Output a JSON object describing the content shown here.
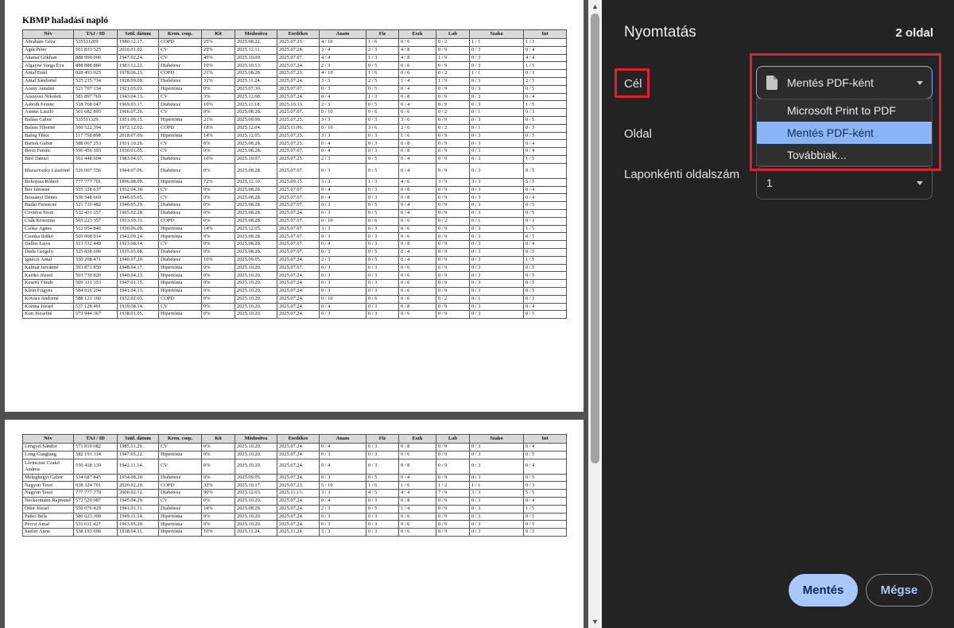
{
  "preview": {
    "doc_title": "KBMP haladási napló",
    "columns": [
      "Név",
      "TAJ / ID",
      "Szül. dátum",
      "Kron. csop.",
      "Kit",
      "Módosítva",
      "Esedékes",
      "Anam",
      "Fiz",
      "Eszk",
      "Lab",
      "Szako",
      "Int"
    ],
    "page1_rows": [
      [
        "Ábrahám Géza",
        "535511209",
        "1980.12.17.",
        "COPD",
        "25%",
        "2025.08.22.",
        "2025.07.23.",
        "4 / 10",
        "1 / 6",
        "0 / 6",
        "0 / 2",
        "1 / 1",
        "1 / 3"
      ],
      [
        "Ágút Péter",
        "561 833 525",
        "2010.01.02.",
        "CV",
        "29%",
        "2025.12.11.",
        "2025.07.28.",
        "3 / 4",
        "2 / 3",
        "4 / 8",
        "0 / 9",
        "0 / 3",
        "0 / 4"
      ],
      [
        "Akarsu Gökhan",
        "888 999 000",
        "1947.02.24.",
        "CV",
        "45%",
        "2025.10.09.",
        "2025.07.07.",
        "4 / 4",
        "1 / 3",
        "4 / 8",
        "1 / 9",
        "0 / 3",
        "4 / 4"
      ],
      [
        "Algayné Varga Éva",
        "888 888 880",
        "1983.12.22.",
        "Diabétesz",
        "10%",
        "2025.10.13.",
        "2025.07.24.",
        "2 / 3",
        "0 / 5",
        "0 / 6",
        "0 / 9",
        "0 / 3",
        "1 / 5"
      ],
      [
        "Antal Emil",
        "028 493 925",
        "1978.06.23.",
        "COPD",
        "21%",
        "2025.08.28.",
        "2025.07.23.",
        "4 / 10",
        "1 / 6",
        "0 / 6",
        "0 / 2",
        "1 / 1",
        "0 / 3"
      ],
      [
        "Antal Sándorné",
        "525 235 734",
        "1928.09.09.",
        "Diabétesz",
        "31%",
        "2025.11.24.",
        "2025.07.24.",
        "3 / 3",
        "2 / 5",
        "1 / 4",
        "1 / 9",
        "0 / 3",
        "2 / 5"
      ],
      [
        "Arany Antalné",
        "521 707 134",
        "1921.05.01.",
        "Hipertónia",
        "0%",
        "2025.07.30.",
        "2025.07.07.",
        "0 / 3",
        "0 / 5",
        "0 / 4",
        "0 / 9",
        "0 / 3",
        "0 / 5"
      ],
      [
        "Aranyosi Nikolett",
        "581 897 769",
        "1943.04.13.",
        "CV",
        "3%",
        "2025.12.08.",
        "2025.07.24.",
        "0 / 4",
        "1 / 3",
        "0 / 8",
        "0 / 9",
        "0 / 3",
        "0 / 4"
      ],
      [
        "Asbóth Ferenc",
        "518 768 047",
        "1969.03.17.",
        "Diabétesz",
        "10%",
        "2025.11.18.",
        "2025.10.13.",
        "2 / 3",
        "0 / 5",
        "0 / 4",
        "0 / 9",
        "0 / 3",
        "1 / 5"
      ],
      [
        "Asmus László",
        "501 682 895",
        "1966.07.26.",
        "CV",
        "0%",
        "2025.08.28.",
        "2025.07.07.",
        "0 / 10",
        "0 / 6",
        "0 / 6",
        "0 / 2",
        "0 / 1",
        "0 / 3"
      ],
      [
        "Baláss Gábor",
        "535511329",
        "1951.09.15.",
        "Hipertónia",
        "21%",
        "2025.09.09.",
        "2025.07.25.",
        "3 / 3",
        "0 / 3",
        "3 / 6",
        "0 / 9",
        "0 / 3",
        "0 / 5"
      ],
      [
        "Baláss Tiborné",
        "560 522 394",
        "1972.12.02.",
        "COPD",
        "18%",
        "2025.12.04.",
        "2025.11.06.",
        "0 / 10",
        "3 / 6",
        "2 / 6",
        "0 / 2",
        "0 / 1",
        "0 / 3"
      ],
      [
        "Balog Tibor",
        "117 758 898",
        "2018.07.09.",
        "Hipertónia",
        "14%",
        "2025.12.05.",
        "2025.07.25.",
        "3 / 3",
        "0 / 3",
        "1 / 6",
        "0 / 9",
        "0 / 3",
        "0 / 5"
      ],
      [
        "Bartok Gábor",
        "588 067 253",
        "1931.10.26.",
        "CV",
        "0%",
        "2025.08.28.",
        "2025.07.25.",
        "0 / 4",
        "0 / 3",
        "0 / 8",
        "0 / 9",
        "0 / 3",
        "0 / 4"
      ],
      [
        "Berzi Ferenc",
        "596 456 393",
        "1930.01.05.",
        "CV",
        "0%",
        "2025.08.28.",
        "2025.07.07.",
        "0 / 4",
        "0 / 3",
        "0 / 8",
        "0 / 9",
        "0 / 3",
        "0 / 4"
      ],
      [
        "Bíró Dániel",
        "561 448 604",
        "1983.04.07.",
        "Diabétesz",
        "10%",
        "2025.10.07.",
        "2025.07.25.",
        "2 / 3",
        "0 / 5",
        "0 / 4",
        "0 / 9",
        "0 / 3",
        "1 / 5"
      ],
      [
        "Blazsovszky Lászlóné",
        "526 007 556",
        "1944.07.06.",
        "Diabétesz",
        "0%",
        "2025.08.28.",
        "2025.07.07.",
        "0 / 3",
        "0 / 5",
        "0 / 4",
        "0 / 9",
        "0 / 3",
        "0 / 5"
      ],
      [
        "Bohojsza Róbert",
        "777 777 701",
        "1996.08.09.",
        "Hipertónia",
        "72%",
        "2025.12.10.",
        "2025.09.15.",
        "3 / 3",
        "1 / 3",
        "4 / 6",
        "3 / 9",
        "3 / 3",
        "5 / 5"
      ],
      [
        "Bor Jánosné",
        "555 328 637",
        "1932.04.30.",
        "CV",
        "0%",
        "2025.08.28.",
        "2025.07.07.",
        "0 / 4",
        "0 / 3",
        "0 / 8",
        "0 / 9",
        "0 / 3",
        "0 / 4"
      ],
      [
        "Bossányi Dénes",
        "530 548 669",
        "1946.05.05.",
        "CV",
        "0%",
        "2025.08.28.",
        "2025.07.07.",
        "0 / 4",
        "0 / 3",
        "0 / 8",
        "0 / 9",
        "0 / 3",
        "0 / 4"
      ],
      [
        "Budai Ferencné",
        "521 710 482",
        "1946.05.29.",
        "Diabétesz",
        "0%",
        "2025.08.28.",
        "2025.07.07.",
        "0 / 3",
        "0 / 5",
        "0 / 4",
        "0 / 9",
        "0 / 3",
        "0 / 5"
      ],
      [
        "Covidos Teszt",
        "532 431 257",
        "1965.02.28.",
        "Diabétesz",
        "0%",
        "2025.08.28.",
        "2025.07.24.",
        "0 / 3",
        "0 / 5",
        "0 / 4",
        "0 / 9",
        "0 / 3",
        "0 / 5"
      ],
      [
        "Csák Krisztina",
        "565 223 357",
        "1933.10.31.",
        "COPD",
        "0%",
        "2025.08.28.",
        "2025.07.07.",
        "0 / 10",
        "0 / 6",
        "0 / 6",
        "0 / 2",
        "0 / 1",
        "0 / 3"
      ],
      [
        "Csóka Ágnes",
        "512 954 846",
        "1930.06.09.",
        "Hipertónia",
        "14%",
        "2025.12.05.",
        "2025.07.07.",
        "3 / 3",
        "0 / 3",
        "0 / 6",
        "0 / 9",
        "0 / 3",
        "1 / 5"
      ],
      [
        "Csonka Ildikó",
        "569 008 914",
        "1942.09.24.",
        "Hipertónia",
        "0%",
        "2025.08.28.",
        "2025.07.07.",
        "0 / 3",
        "0 / 3",
        "0 / 6",
        "0 / 9",
        "0 / 3",
        "0 / 5"
      ],
      [
        "Dallos Lajos",
        "513 532 449",
        "1923.08.14.",
        "CV",
        "0%",
        "2025.08.28.",
        "2025.07.07.",
        "0 / 4",
        "0 / 3",
        "0 / 8",
        "0 / 9",
        "0 / 3",
        "0 / 4"
      ],
      [
        "Duda Gergely",
        "525 838 696",
        "1935.03.08.",
        "Diabétesz",
        "0%",
        "2025.08.28.",
        "2025.07.07.",
        "0 / 3",
        "0 / 5",
        "0 / 4",
        "0 / 9",
        "0 / 3",
        "0 / 5"
      ],
      [
        "Ignéczi Antal",
        "550 208 471",
        "1940.07.20.",
        "Diabétesz",
        "10%",
        "2025.09.05.",
        "2025.07.24.",
        "2 / 3",
        "0 / 5",
        "0 / 4",
        "0 / 9",
        "0 / 3",
        "1 / 5"
      ],
      [
        "Kalmár Istvánné",
        "593 871 850",
        "1948.04.17.",
        "Hipertónia",
        "0%",
        "2025.10.20.",
        "2025.07.07.",
        "0 / 3",
        "0 / 3",
        "0 / 6",
        "0 / 9",
        "0 / 3",
        "0 / 5"
      ],
      [
        "Karikó József",
        "503 730 820",
        "1940.04.23.",
        "Hipertónia",
        "0%",
        "2025.10.20.",
        "2025.07.24.",
        "0 / 3",
        "0 / 3",
        "0 / 6",
        "0 / 9",
        "0 / 3",
        "0 / 5"
      ],
      [
        "Keserű Tünde",
        "509 331 353",
        "1947.01.15.",
        "Hipertónia",
        "0%",
        "2025.10.20.",
        "2025.07.24.",
        "0 / 3",
        "0 / 3",
        "0 / 6",
        "0 / 9",
        "0 / 3",
        "0 / 5"
      ],
      [
        "Klein Frigyes",
        "584 016 204",
        "1941.04.13.",
        "Hipertónia",
        "0%",
        "2025.10.20.",
        "2025.07.24.",
        "0 / 3",
        "0 / 3",
        "0 / 6",
        "0 / 9",
        "0 / 3",
        "0 / 5"
      ],
      [
        "Kovács Andorné",
        "588 121 160",
        "1932.02.03.",
        "COPD",
        "0%",
        "2025.10.20.",
        "2025.07.24.",
        "0 / 10",
        "0 / 6",
        "0 / 6",
        "0 / 2",
        "0 / 1",
        "0 / 3"
      ],
      [
        "Kozma József",
        "537 128 491",
        "1939.08.14.",
        "CV",
        "0%",
        "2025.10.20.",
        "2025.07.24.",
        "0 / 4",
        "0 / 3",
        "0 / 8",
        "0 / 9",
        "0 / 3",
        "0 / 4"
      ],
      [
        "Kun Józsefné",
        "573 944 367",
        "1938.01.05.",
        "Hipertónia",
        "0%",
        "2025.10.20.",
        "2025.07.24.",
        "0 / 3",
        "0 / 3",
        "0 / 6",
        "0 / 9",
        "0 / 3",
        "0 / 5"
      ]
    ],
    "page2_rows": [
      [
        "Lengyel Sándor",
        "571 810 082",
        "1985.11.29.",
        "CV",
        "0%",
        "2025.10.20.",
        "2025.07.24.",
        "0 / 4",
        "0 / 3",
        "0 / 8",
        "0 / 9",
        "0 / 3",
        "0 / 4"
      ],
      [
        "Long Guagiang",
        "582 191 314",
        "1947.05.22.",
        "Hipertónia",
        "0%",
        "2025.10.20.",
        "2025.07.24.",
        "0 / 3",
        "0 / 3",
        "0 / 6",
        "0 / 9",
        "0 / 3",
        "0 / 5"
      ],
      [
        "Lőrinczné Czakó Andrea",
        "556 418 139",
        "1942.11.14.",
        "CV",
        "0%",
        "2025.10.20.",
        "2025.07.24.",
        "0 / 4",
        "0 / 3",
        "0 / 8",
        "0 / 9",
        "0 / 3",
        "0 / 4"
      ],
      [
        "Meleghegyi Gábor",
        "534 687 845",
        "1934.08.20.",
        "Diabétesz",
        "0%",
        "2025.09.05.",
        "2025.07.24.",
        "0 / 3",
        "0 / 5",
        "0 / 4",
        "0 / 9",
        "0 / 3",
        "0 / 5"
      ],
      [
        "Nagyon Teszt",
        "038 324 701",
        "2020.02.20.",
        "COPD",
        "32%",
        "2025.10.17.",
        "2025.07.23.",
        "5 / 10",
        "1 / 6",
        "1 / 6",
        "1 / 2",
        "1 / 1",
        "0 / 3"
      ],
      [
        "Nagyon Teszt",
        "777 777 770",
        "2000.02.12.",
        "Diabétesz",
        "90%",
        "2025.12.03.",
        "2025.11.13.",
        "3 / 3",
        "4 / 5",
        "4 / 4",
        "7 / 9",
        "3 / 3",
        "5 / 5"
      ],
      [
        "Neckermann Rajmund",
        "572 529 987",
        "1945.04.29.",
        "CV",
        "0%",
        "2025.10.20.",
        "2025.07.24.",
        "0 / 4",
        "0 / 3",
        "0 / 8",
        "0 / 9",
        "0 / 3",
        "0 / 4"
      ],
      [
        "Odor József",
        "550 076 429",
        "1941.01.11.",
        "Diabétesz",
        "14%",
        "2025.08.28.",
        "2025.07.24.",
        "2 / 3",
        "0 / 5",
        "1 / 4",
        "0 / 9",
        "0 / 3",
        "1 / 5"
      ],
      [
        "Patkó Béla",
        "580 023 369",
        "1949.11.14.",
        "Hipertónia",
        "0%",
        "2025.10.20.",
        "2025.07.24.",
        "0 / 3",
        "0 / 3",
        "0 / 6",
        "0 / 9",
        "0 / 3",
        "0 / 5"
      ],
      [
        "Pércsi Antal",
        "531 611 427",
        "1963.05.20.",
        "Hipertónia",
        "0%",
        "2025.10.20.",
        "2025.07.24.",
        "0 / 3",
        "0 / 3",
        "0 / 6",
        "0 / 9",
        "0 / 3",
        "0 / 5"
      ],
      [
        "Sattler Anna",
        "538 193 696",
        "1938.04.11.",
        "Hipertónia",
        "10%",
        "2025.11.24.",
        "2025.11.24.",
        "3 / 3",
        "0 / 3",
        "0 / 6",
        "0 / 9",
        "0 / 3",
        "0 / 5"
      ]
    ]
  },
  "panel": {
    "title": "Nyomtatás",
    "page_count": "2 oldal",
    "destination_label": "Cél",
    "destination_value": "Mentés PDF-ként",
    "destination_options": [
      "Microsoft Print to PDF",
      "Mentés PDF-ként",
      "Továbbiak..."
    ],
    "pages_label": "Oldal",
    "pages_per_sheet_label": "Laponkénti oldalszám",
    "pages_per_sheet_value": "1",
    "save_button": "Mentés",
    "cancel_button": "Mégse"
  },
  "colors": {
    "highlight_box": "#e0202a",
    "accent": "#a8c7fa",
    "selected_option": "#8ab4f8",
    "panel_bg": "#232323"
  },
  "icons": [
    "file-icon",
    "chevron-down-icon",
    "scroll-up-arrow",
    "scroll-down-arrow"
  ]
}
